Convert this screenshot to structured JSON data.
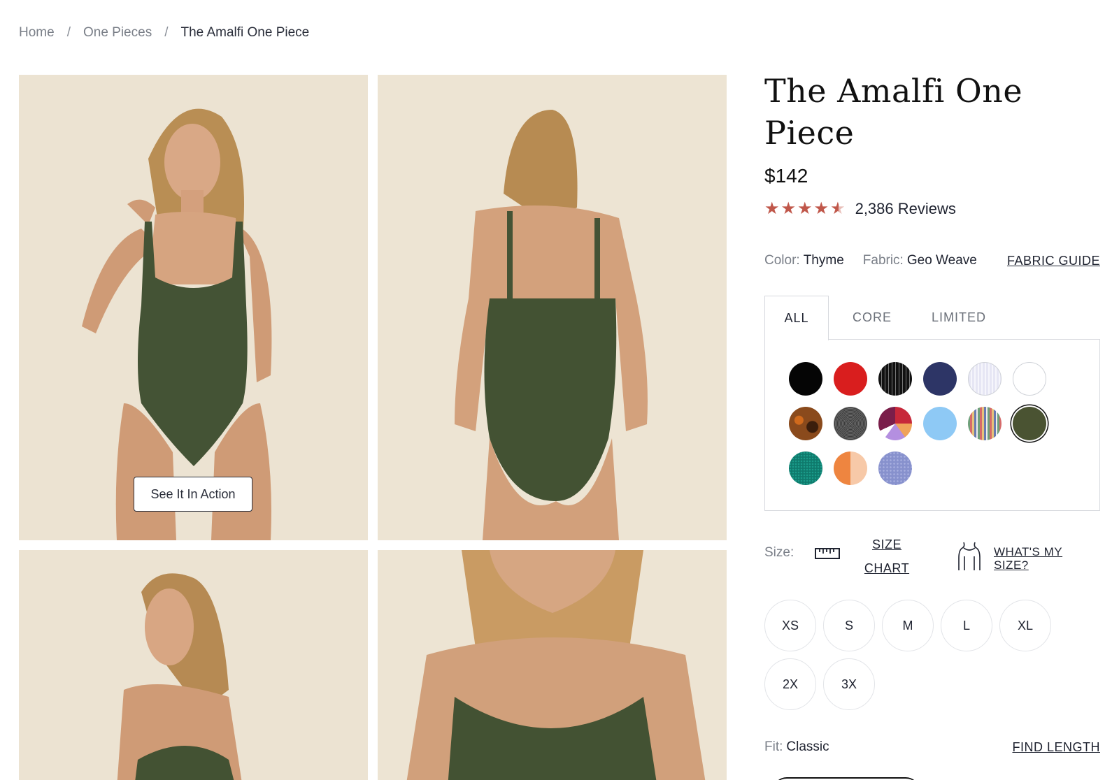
{
  "breadcrumb": {
    "items": [
      "Home",
      "One Pieces",
      "The Amalfi One Piece"
    ],
    "separator": "/"
  },
  "gallery": {
    "action_button": "See It In Action"
  },
  "product": {
    "title": "The Amalfi One Piece",
    "price": "$142",
    "rating": 4.5,
    "reviews": "2,386 Reviews",
    "star_color": "#c0574a"
  },
  "attributes": {
    "color_label": "Color:",
    "color_value": "Thyme",
    "fabric_label": "Fabric:",
    "fabric_value": "Geo Weave",
    "fabric_guide": "FABRIC GUIDE"
  },
  "color_tabs": [
    "ALL",
    "CORE",
    "LIMITED"
  ],
  "active_tab": "ALL",
  "swatches": [
    {
      "name": "black",
      "color": "#050505"
    },
    {
      "name": "red",
      "color": "#d91e1e"
    },
    {
      "name": "black-pinstripe",
      "color": "#1a1a1a"
    },
    {
      "name": "navy",
      "color": "#2d3566"
    },
    {
      "name": "lavender-white",
      "color": "#e8e8f5"
    },
    {
      "name": "white",
      "color": "#ffffff"
    },
    {
      "name": "brown-pattern",
      "color": "#8a4a1c"
    },
    {
      "name": "charcoal-texture",
      "color": "#4a4a4a"
    },
    {
      "name": "abstract-print",
      "color": "#c7283a"
    },
    {
      "name": "sky-blue",
      "color": "#8ec9f5"
    },
    {
      "name": "multi-stripe",
      "color": "#a58d85"
    },
    {
      "name": "thyme",
      "color": "#4a5332"
    },
    {
      "name": "teal",
      "color": "#0f7a6c"
    },
    {
      "name": "orange-peach",
      "color": "#ee8540"
    },
    {
      "name": "periwinkle-dot",
      "color": "#8791cd"
    }
  ],
  "selected_swatch": "thyme",
  "size": {
    "label": "Size:",
    "size_chart": "SIZE CHART",
    "whats_my_size": "WHAT'S MY SIZE?",
    "options": [
      "XS",
      "S",
      "M",
      "L",
      "XL",
      "2X",
      "3X"
    ]
  },
  "fit": {
    "label": "Fit:",
    "value": "Classic",
    "find_length": "FIND LENGTH"
  }
}
